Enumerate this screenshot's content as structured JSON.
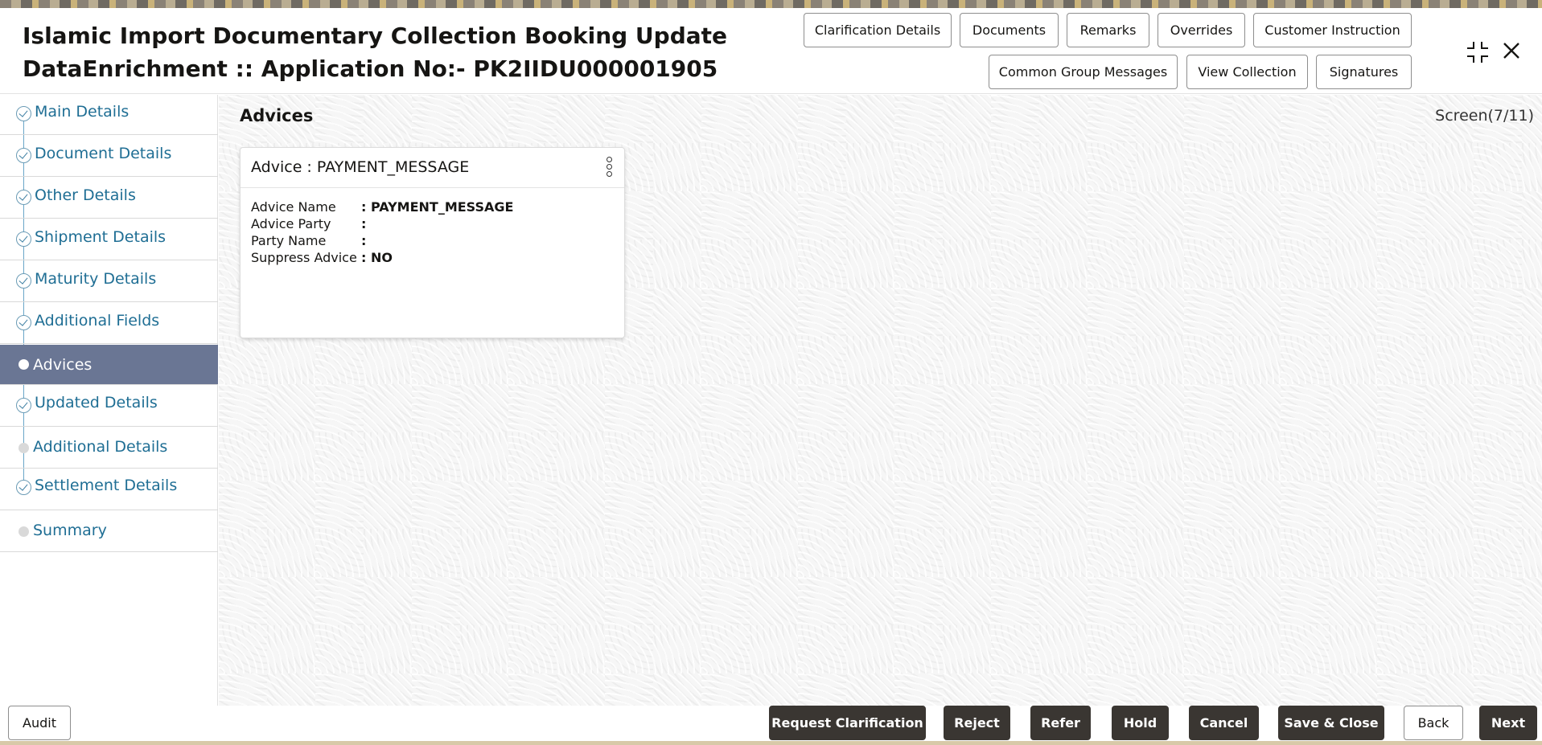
{
  "header": {
    "title_line1": "Islamic Import Documentary Collection Booking Update",
    "title_line2": "DataEnrichment :: Application No:- PK2IIDU000001905",
    "buttons_row1": [
      "Clarification Details",
      "Documents",
      "Remarks",
      "Overrides",
      "Customer Instruction"
    ],
    "buttons_row2": [
      "Common Group Messages",
      "View Collection",
      "Signatures"
    ],
    "minimize_icon": "compress-icon",
    "close_icon": "close-icon"
  },
  "sidebar": {
    "items": [
      {
        "label": "Main Details",
        "state": "done"
      },
      {
        "label": "Document Details",
        "state": "done"
      },
      {
        "label": "Other Details",
        "state": "done"
      },
      {
        "label": "Shipment Details",
        "state": "done"
      },
      {
        "label": "Maturity Details",
        "state": "done"
      },
      {
        "label": "Additional Fields",
        "state": "done"
      },
      {
        "label": "Advices",
        "state": "active"
      },
      {
        "label": "Updated Details",
        "state": "done"
      },
      {
        "label": "Additional Details",
        "state": "pending"
      },
      {
        "label": "Settlement Details",
        "state": "done"
      },
      {
        "label": "Summary",
        "state": "pending"
      }
    ]
  },
  "main": {
    "section_title": "Advices",
    "screen_count": "Screen(7/11)",
    "card": {
      "title": "Advice : PAYMENT_MESSAGE",
      "rows": [
        {
          "key": "Advice Name",
          "value": ": PAYMENT_MESSAGE"
        },
        {
          "key": "Advice Party",
          "value": ":"
        },
        {
          "key": "Party Name",
          "value": ":"
        },
        {
          "key": "Suppress Advice",
          "value": ": NO"
        }
      ]
    }
  },
  "footer": {
    "audit": "Audit",
    "request_clarification": "Request Clarification",
    "reject": "Reject",
    "refer": "Refer",
    "hold": "Hold",
    "cancel": "Cancel",
    "save_close": "Save & Close",
    "back": "Back",
    "next": "Next"
  },
  "colors": {
    "active_nav": "#6a7694",
    "link": "#1f6e94",
    "dark_button": "#3a3632"
  }
}
